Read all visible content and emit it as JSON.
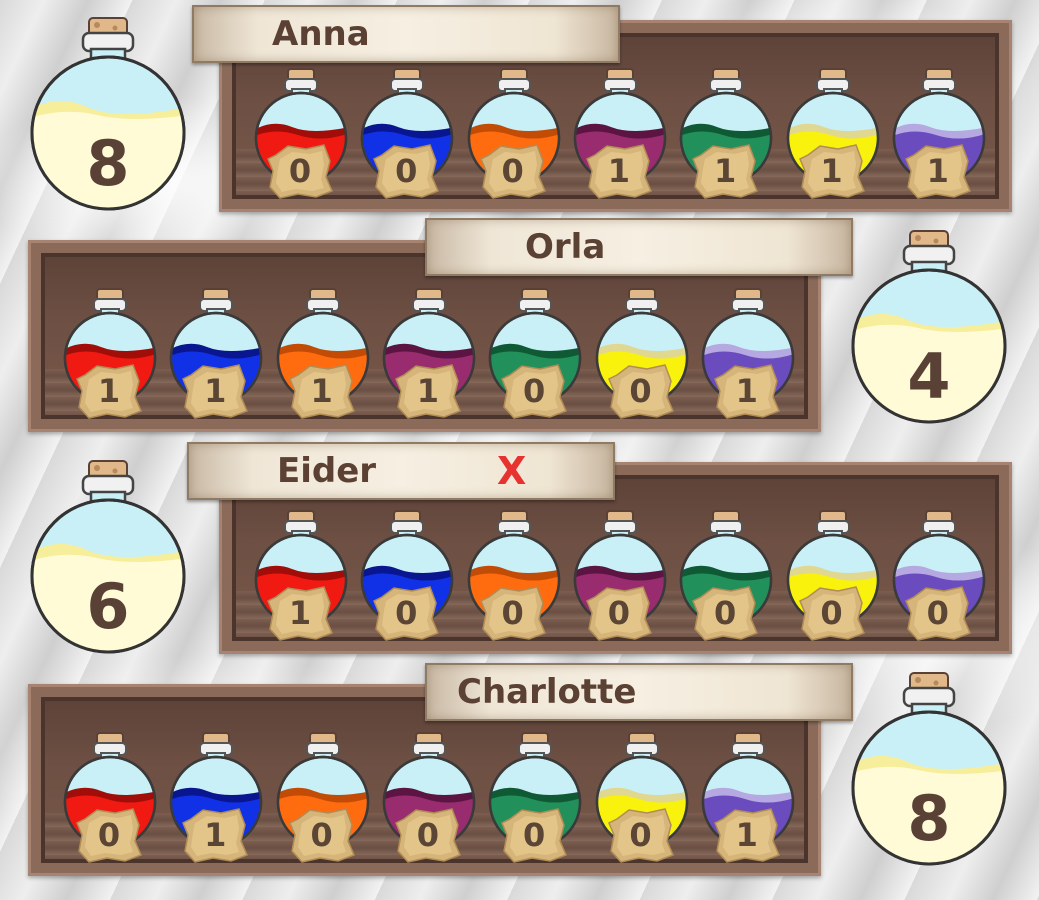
{
  "players": [
    {
      "name": "Anna",
      "total": "8",
      "marker": "",
      "counts": [
        "0",
        "0",
        "0",
        "1",
        "1",
        "1",
        "1"
      ]
    },
    {
      "name": "Orla",
      "total": "4",
      "marker": "",
      "counts": [
        "1",
        "1",
        "1",
        "1",
        "0",
        "0",
        "1"
      ]
    },
    {
      "name": "Eider",
      "total": "6",
      "marker": "X",
      "counts": [
        "1",
        "0",
        "0",
        "0",
        "0",
        "0",
        "0"
      ]
    },
    {
      "name": "Charlotte",
      "total": "8",
      "marker": "",
      "counts": [
        "0",
        "1",
        "0",
        "0",
        "0",
        "0",
        "1"
      ]
    }
  ],
  "potion_colors": [
    {
      "name": "red",
      "liquid": "#f01a12",
      "dark": "#a10d08"
    },
    {
      "name": "blue",
      "liquid": "#1131e6",
      "dark": "#0a1690"
    },
    {
      "name": "orange",
      "liquid": "#ff6b0f",
      "dark": "#c24b06"
    },
    {
      "name": "purple",
      "liquid": "#982c6e",
      "dark": "#5c1542"
    },
    {
      "name": "green",
      "liquid": "#22905a",
      "dark": "#0f5a34"
    },
    {
      "name": "yellow",
      "liquid": "#f8f20c",
      "dark": "#e0d890"
    },
    {
      "name": "violet",
      "liquid": "#6a4cbf",
      "dark": "#b6a8e0"
    }
  ],
  "colors": {
    "glass": "#c9f0f6",
    "big_liquid": "#fffbd6",
    "big_liquid_band": "#f6ee9a",
    "cork": "#e1b88a",
    "text_brown": "#5a4136",
    "marker_red": "#e8322f"
  }
}
